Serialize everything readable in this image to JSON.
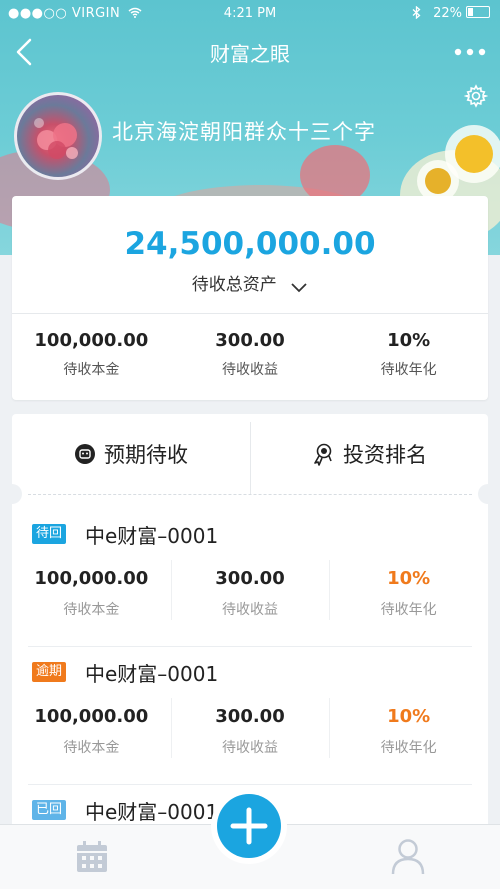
{
  "status_bar": {
    "carrier": "●●●○○ VIRGIN",
    "time": "4:21 PM",
    "battery": "22%"
  },
  "nav": {
    "title": "财富之眼"
  },
  "profile": {
    "name": "北京海淀朝阳群众十三个字"
  },
  "summary": {
    "total_value": "24,500,000.00",
    "total_label": "待收总资产",
    "stats": [
      {
        "value": "100,000.00",
        "label": "待收本金"
      },
      {
        "value": "300.00",
        "label": "待收收益"
      },
      {
        "value": "10%",
        "label": "待收年化"
      }
    ]
  },
  "tabs": [
    {
      "label": "预期待收"
    },
    {
      "label": "投资排名"
    }
  ],
  "items": [
    {
      "badge": "待回",
      "badge_color": "#1ba5e0",
      "name": "中e财富–0001",
      "principal": "100,000.00",
      "principal_label": "待收本金",
      "income": "300.00",
      "income_label": "待收收益",
      "rate": "10%",
      "rate_label": "待收年化"
    },
    {
      "badge": "逾期",
      "badge_color": "#f07a1c",
      "name": "中e财富–0001",
      "principal": "100,000.00",
      "principal_label": "待收本金",
      "income": "300.00",
      "income_label": "待收收益",
      "rate": "10%",
      "rate_label": "待收年化"
    },
    {
      "badge": "已回",
      "badge_color": "#5fb4e8",
      "name": "中e财富–0001"
    }
  ],
  "colors": {
    "accent": "#1ba5e0",
    "orange": "#f07a1c",
    "header": "#5cc4cf"
  },
  "icons": [
    "back-icon",
    "more-icon",
    "gear-icon",
    "chevron-down-icon",
    "face-icon",
    "ranking-icon",
    "calendar-icon",
    "plus-icon",
    "user-icon",
    "wifi-icon",
    "bluetooth-icon",
    "battery-icon"
  ]
}
